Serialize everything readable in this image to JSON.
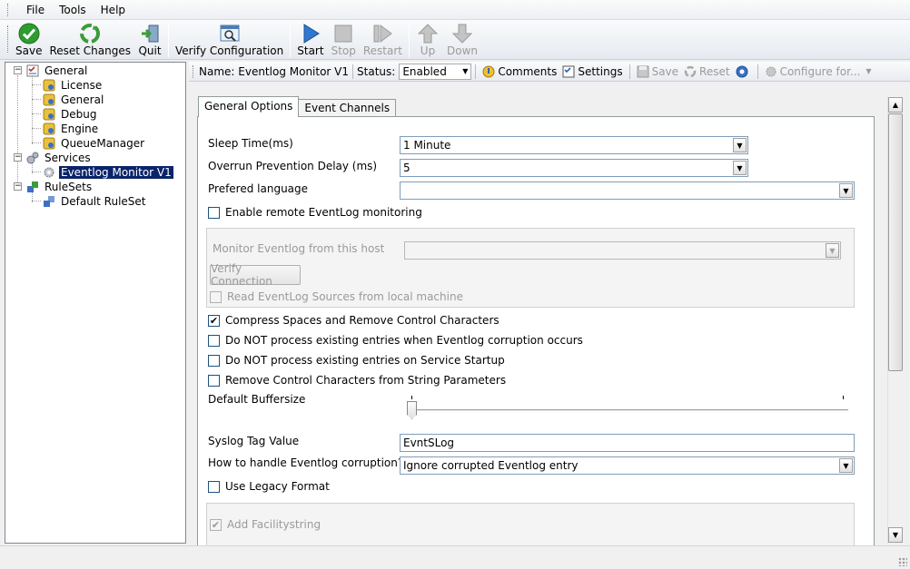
{
  "menu": {
    "items": [
      "File",
      "Tools",
      "Help"
    ]
  },
  "toolbar": {
    "buttons": [
      {
        "label": "Save",
        "icon": "green-check-icon"
      },
      {
        "label": "Reset Changes",
        "icon": "recycle-icon"
      },
      {
        "label": "Quit",
        "icon": "quit-door-icon"
      },
      {
        "label": "Verify Configuration",
        "icon": "magnifier-window-icon"
      },
      {
        "label": "Start",
        "icon": "play-icon"
      },
      {
        "label": "Stop",
        "icon": "stop-icon"
      },
      {
        "label": "Restart",
        "icon": "restart-icon"
      },
      {
        "label": "Up",
        "icon": "arrow-up-icon"
      },
      {
        "label": "Down",
        "icon": "arrow-down-icon"
      }
    ]
  },
  "tree": {
    "general": "General",
    "license": "License",
    "general_child": "General",
    "debug": "Debug",
    "engine": "Engine",
    "queue_manager": "QueueManager",
    "services": "Services",
    "eventlog_monitor": "Eventlog Monitor V1",
    "rulesets": "RuleSets",
    "default_ruleset": "Default RuleSet",
    "expander_minus": "−"
  },
  "header": {
    "name_label": "Name: Eventlog Monitor V1",
    "status_label": "Status:",
    "status_value": "Enabled",
    "comments": "Comments",
    "settings": "Settings",
    "save": "Save",
    "reset": "Reset",
    "configure_for": "Configure for..."
  },
  "tabs": {
    "general_options": "General Options",
    "event_channels": "Event Channels"
  },
  "form": {
    "sleep_time_label": "Sleep Time(ms)",
    "sleep_time_value": "1 Minute",
    "overrun_label": "Overrun Prevention Delay (ms)",
    "overrun_value": "5",
    "language_label": "Prefered language",
    "language_value": "",
    "enable_remote": "Enable remote EventLog monitoring",
    "monitor_host_label": "Monitor Eventlog from this host",
    "verify_connection": "Verify Connection",
    "read_sources": "Read EventLog Sources from local machine",
    "compress_spaces": "Compress Spaces and Remove Control Characters",
    "no_process_corruption": "Do NOT process existing entries when Eventlog corruption occurs",
    "no_process_startup": "Do NOT process existing entries on Service Startup",
    "remove_control_chars": "Remove Control Characters from String Parameters",
    "default_buffersize_label": "Default Buffersize",
    "buffersize_level": 0,
    "syslog_tag_label": "Syslog Tag Value",
    "syslog_tag_value": "EvntSLog",
    "corruption_label": "How to handle Eventlog corruption?",
    "corruption_value": "Ignore corrupted Eventlog entry",
    "use_legacy": "Use Legacy Format",
    "add_facility": "Add Facilitystring"
  },
  "checks": {
    "mark": "✔"
  },
  "glyphs": {
    "combo_arrow": "▼",
    "scroll_up": "▲",
    "scroll_down": "▼"
  }
}
